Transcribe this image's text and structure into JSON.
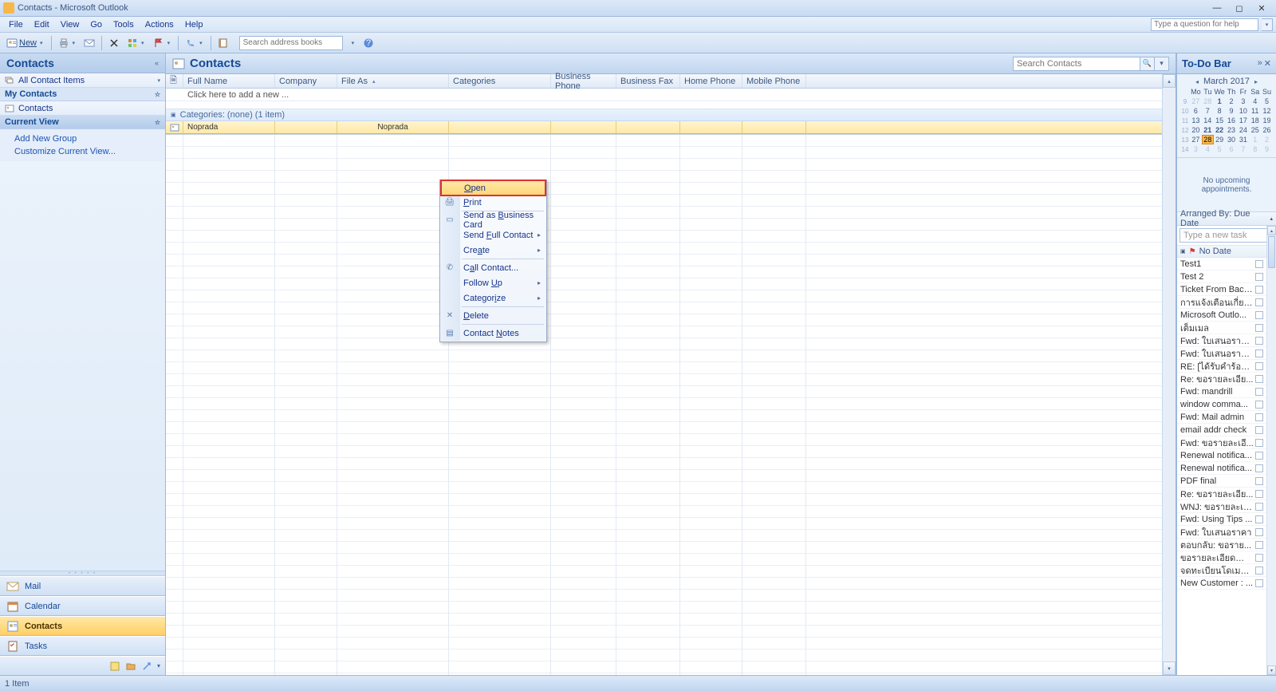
{
  "window": {
    "title": "Contacts - Microsoft Outlook"
  },
  "menu": {
    "file": "File",
    "edit": "Edit",
    "view": "View",
    "go": "Go",
    "tools": "Tools",
    "actions": "Actions",
    "help": "Help",
    "ask_placeholder": "Type a question for help"
  },
  "toolbar": {
    "new": "New",
    "search_placeholder": "Search address books"
  },
  "nav": {
    "title": "Contacts",
    "all_items": "All Contact Items",
    "my_contacts": "My Contacts",
    "contacts": "Contacts",
    "current_view": "Current View",
    "add_group": "Add New Group",
    "customize": "Customize Current View...",
    "buttons": {
      "mail": "Mail",
      "calendar": "Calendar",
      "contacts": "Contacts",
      "tasks": "Tasks"
    }
  },
  "content": {
    "title": "Contacts",
    "search_placeholder": "Search Contacts",
    "columns": {
      "fullname": "Full Name",
      "company": "Company",
      "fileas": "File As",
      "categories": "Categories",
      "busphone": "Business Phone",
      "busfax": "Business Fax",
      "homephone": "Home Phone",
      "mobilephone": "Mobile Phone"
    },
    "newrow": "Click here to add a new ...",
    "category_label": "Categories: (none) (1 item)",
    "row": {
      "name": "Noprada",
      "fileas": "Noprada"
    }
  },
  "context_menu": {
    "open": "Open",
    "print": "Print",
    "send_bcard": "Send as Business Card",
    "send_full": "Send Full Contact",
    "create": "Create",
    "call": "Call Contact...",
    "follow": "Follow Up",
    "categorize": "Categorize",
    "delete": "Delete",
    "notes": "Contact Notes"
  },
  "todo": {
    "title": "To-Do Bar",
    "cal_title": "March 2017",
    "dayhdr": [
      "Mo",
      "Tu",
      "We",
      "Th",
      "Fr",
      "Sa",
      "Su"
    ],
    "weeks": [
      {
        "wk": "9",
        "days": [
          {
            "d": "27",
            "o": true
          },
          {
            "d": "28",
            "o": true
          },
          {
            "d": "1",
            "b": true
          },
          {
            "d": "2"
          },
          {
            "d": "3"
          },
          {
            "d": "4"
          },
          {
            "d": "5"
          }
        ]
      },
      {
        "wk": "10",
        "days": [
          {
            "d": "6"
          },
          {
            "d": "7"
          },
          {
            "d": "8"
          },
          {
            "d": "9"
          },
          {
            "d": "10"
          },
          {
            "d": "11"
          },
          {
            "d": "12"
          }
        ]
      },
      {
        "wk": "11",
        "days": [
          {
            "d": "13"
          },
          {
            "d": "14"
          },
          {
            "d": "15"
          },
          {
            "d": "16"
          },
          {
            "d": "17"
          },
          {
            "d": "18"
          },
          {
            "d": "19"
          }
        ]
      },
      {
        "wk": "12",
        "days": [
          {
            "d": "20"
          },
          {
            "d": "21",
            "b": true
          },
          {
            "d": "22",
            "b": true
          },
          {
            "d": "23"
          },
          {
            "d": "24"
          },
          {
            "d": "25"
          },
          {
            "d": "26"
          }
        ]
      },
      {
        "wk": "13",
        "days": [
          {
            "d": "27"
          },
          {
            "d": "28",
            "t": true
          },
          {
            "d": "29"
          },
          {
            "d": "30"
          },
          {
            "d": "31"
          },
          {
            "d": "1",
            "o": true
          },
          {
            "d": "2",
            "o": true
          }
        ]
      },
      {
        "wk": "14",
        "days": [
          {
            "d": "3",
            "o": true
          },
          {
            "d": "4",
            "o": true
          },
          {
            "d": "5",
            "o": true
          },
          {
            "d": "6",
            "o": true
          },
          {
            "d": "7",
            "o": true
          },
          {
            "d": "8",
            "o": true
          },
          {
            "d": "9",
            "o": true
          }
        ]
      }
    ],
    "no_appt": "No upcoming appointments.",
    "arranged": "Arranged By: Due Date",
    "new_task": "Type a new task",
    "group": "No Date",
    "tasks": [
      "Test1",
      "Test 2",
      "Ticket From Back...",
      "การแจ้งเตือนเกี่ยวก...",
      "Microsoft Outlo...",
      "เต็มเมล",
      "Fwd: ใบเสนอราค...",
      "Fwd: ใบเสนอราค...",
      "RE: [ได้รับคำร้องข...",
      "Re: ขอรายละเอีย...",
      "Fwd: mandrill",
      "window comma...",
      "Fwd: Mail admin",
      "email addr check",
      "Fwd: ขอรายละเอี...",
      "Renewal notifica...",
      "Renewal notifica...",
      "PDF final",
      "Re: ขอรายละเอีย...",
      "WNJ: ขอรายละเอี...",
      "Fwd: Using Tips ...",
      "Fwd: ใบเสนอราคา",
      "ตอบกลับ: ขอราย...",
      "ขอรายละเอียดสำห...",
      "จดทะเบียนโดเมน...",
      "New Customer : ..."
    ]
  },
  "status": {
    "items": "1 Item"
  }
}
